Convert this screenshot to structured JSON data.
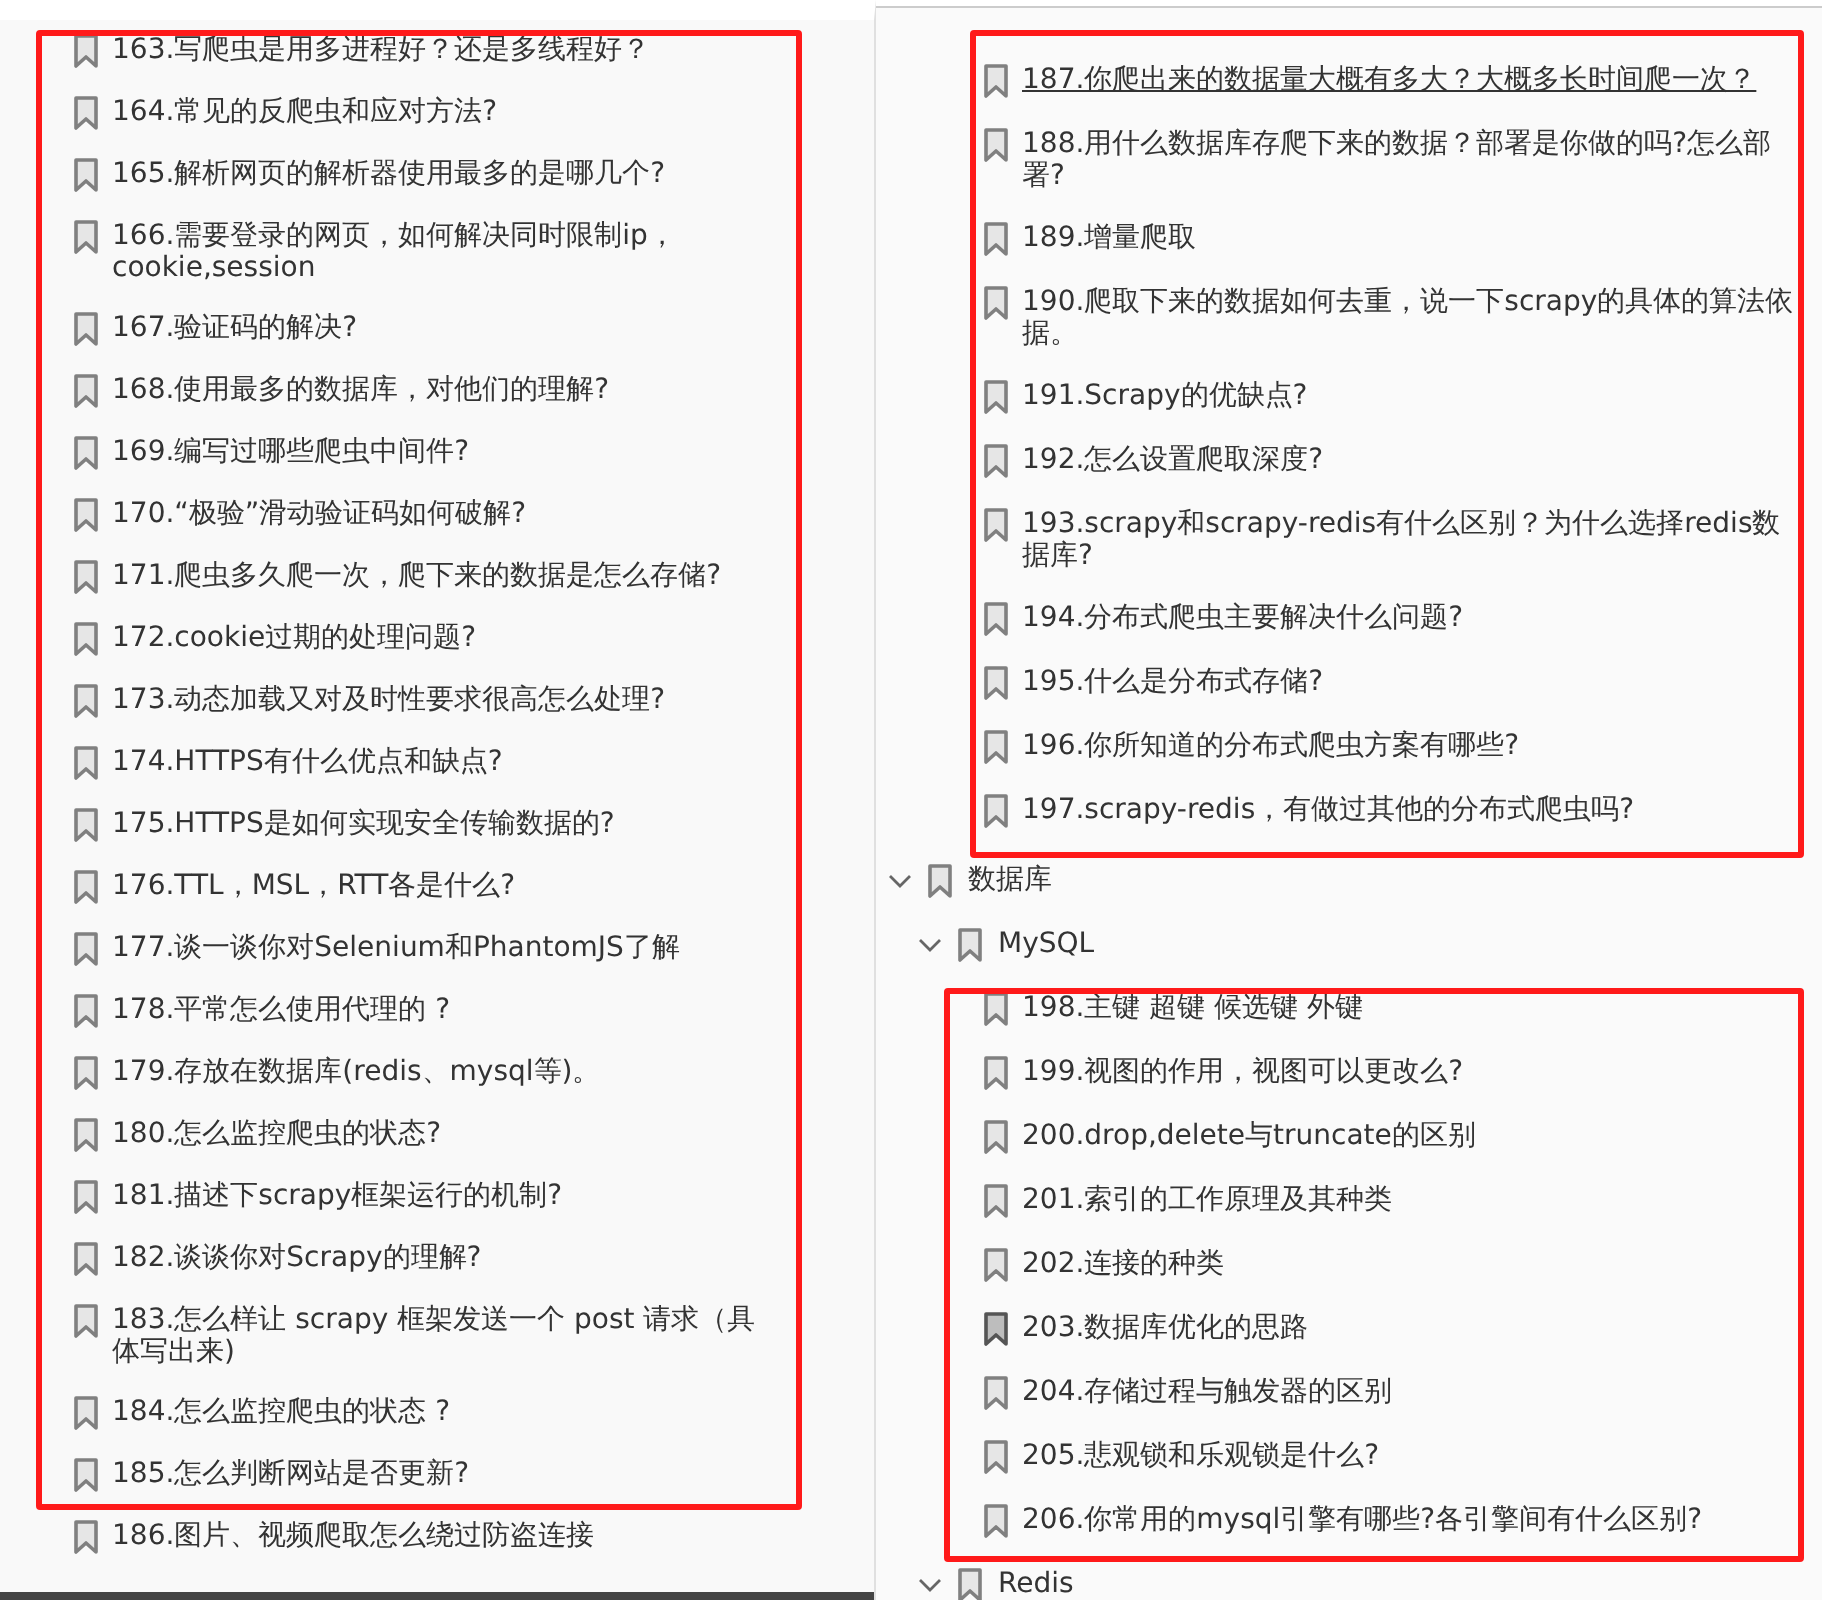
{
  "left_panel": {
    "highlighted": true,
    "items": [
      {
        "label": "163.写爬虫是用多进程好？还是多线程好？"
      },
      {
        "label": "164.常见的反爬虫和应对方法?"
      },
      {
        "label": "165.解析网页的解析器使用最多的是哪几个?"
      },
      {
        "label": "166.需要登录的网页，如何解决同时限制ip，cookie,session"
      },
      {
        "label": "167.验证码的解决?"
      },
      {
        "label": "168.使用最多的数据库，对他们的理解?"
      },
      {
        "label": "169.编写过哪些爬虫中间件?"
      },
      {
        "label": "170.“极验”滑动验证码如何破解?"
      },
      {
        "label": "171.爬虫多久爬一次，爬下来的数据是怎么存储?"
      },
      {
        "label": "172.cookie过期的处理问题?"
      },
      {
        "label": "173.动态加载又对及时性要求很高怎么处理?"
      },
      {
        "label": "174.HTTPS有什么优点和缺点?"
      },
      {
        "label": "175.HTTPS是如何实现安全传输数据的?"
      },
      {
        "label": "176.TTL，MSL，RTT各是什么?"
      },
      {
        "label": "177.谈一谈你对Selenium和PhantomJS了解"
      },
      {
        "label": "178.平常怎么使用代理的 ?"
      },
      {
        "label": "179.存放在数据库(redis、mysql等)。"
      },
      {
        "label": "180.怎么监控爬虫的状态?"
      },
      {
        "label": "181.描述下scrapy框架运行的机制?"
      },
      {
        "label": "182.谈谈你对Scrapy的理解?"
      },
      {
        "label": "183.怎么样让 scrapy 框架发送一个 post 请求（具体写出来)"
      },
      {
        "label": "184.怎么监控爬虫的状态 ?"
      },
      {
        "label": "185.怎么判断网站是否更新?"
      },
      {
        "label": "186.图片、视频爬取怎么绕过防盗连接"
      }
    ]
  },
  "right_panel": {
    "top_group": {
      "highlighted": true,
      "items": [
        {
          "label": "187.你爬出来的数据量大概有多大？大概多长时间爬一次？",
          "hovered": true
        },
        {
          "label": "188.用什么数据库存爬下来的数据？部署是你做的吗?怎么部署?",
          "hovered": false
        },
        {
          "label": "189.增量爬取",
          "hovered": false
        },
        {
          "label": "190.爬取下来的数据如何去重，说一下scrapy的具体的算法依据。",
          "hovered": false
        },
        {
          "label": "191.Scrapy的优缺点?",
          "hovered": false
        },
        {
          "label": "192.怎么设置爬取深度?",
          "hovered": false
        },
        {
          "label": "193.scrapy和scrapy-redis有什么区别？为什么选择redis数据库?",
          "hovered": false
        },
        {
          "label": "194.分布式爬虫主要解决什么问题?",
          "hovered": false
        },
        {
          "label": "195.什么是分布式存储?",
          "hovered": false
        },
        {
          "label": "196.你所知道的分布式爬虫方案有哪些?",
          "hovered": false
        },
        {
          "label": "197.scrapy-redis，有做过其他的分布式爬虫吗?",
          "hovered": false
        }
      ]
    },
    "tree": [
      {
        "label": "数据库",
        "expanded": true,
        "children": [
          {
            "label": "MySQL",
            "expanded": true,
            "highlighted": true,
            "children": [
              {
                "label": "198.主键 超键 候选键 外键",
                "selected": false
              },
              {
                "label": "199.视图的作用，视图可以更改么?",
                "selected": false
              },
              {
                "label": "200.drop,delete与truncate的区别",
                "selected": false
              },
              {
                "label": "201.索引的工作原理及其种类",
                "selected": false
              },
              {
                "label": "202.连接的种类",
                "selected": false
              },
              {
                "label": "203.数据库优化的思路",
                "selected": true
              },
              {
                "label": "204.存储过程与触发器的区别",
                "selected": false
              },
              {
                "label": "205.悲观锁和乐观锁是什么?",
                "selected": false
              },
              {
                "label": "206.你常用的mysql引擎有哪些?各引擎间有什么区别?",
                "selected": false
              }
            ]
          },
          {
            "label": "Redis",
            "expanded": true
          }
        ]
      }
    ]
  }
}
